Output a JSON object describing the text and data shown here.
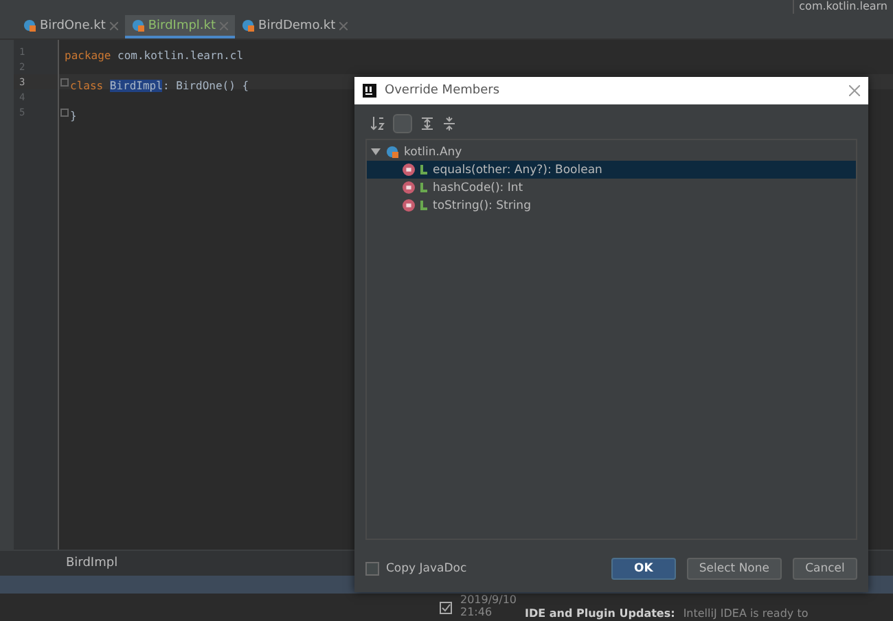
{
  "toolbar": {
    "project_field": "com.kotlin.learn"
  },
  "tabs": [
    {
      "label": "BirdOne.kt",
      "selected": false
    },
    {
      "label": "BirdImpl.kt",
      "selected": true
    },
    {
      "label": "BirdDemo.kt",
      "selected": false
    }
  ],
  "editor": {
    "lines": [
      {
        "number": "1",
        "current": false,
        "fold": false,
        "tokens": [
          {
            "kind": "keyword",
            "text": "package"
          },
          {
            "kind": "plain",
            "text": " com.kotlin.learn.cl"
          }
        ]
      },
      {
        "number": "2",
        "current": false,
        "fold": false
      },
      {
        "number": "3",
        "current": true,
        "fold": true,
        "tokens": [
          {
            "kind": "keyword",
            "text": "class "
          },
          {
            "kind": "highlight",
            "text": "BirdImpl"
          },
          {
            "kind": "plain",
            "text": ": BirdOne() {"
          }
        ]
      },
      {
        "number": "4",
        "current": false,
        "fold": false
      },
      {
        "number": "5",
        "current": false,
        "fold": true,
        "tokens": [
          {
            "kind": "plain",
            "text": "}"
          }
        ]
      }
    ],
    "breadcrumb": "BirdImpl"
  },
  "dialog": {
    "title": "Override Members",
    "tree": {
      "label": "kotlin.Any",
      "expanded": true,
      "children": [
        {
          "label": "equals(other: Any?): Boolean",
          "selected": true
        },
        {
          "label": "hashCode(): Int",
          "selected": false
        },
        {
          "label": "toString(): String",
          "selected": false
        }
      ]
    },
    "copy_javadoc": {
      "label": "Copy JavaDoc",
      "checked": false
    },
    "buttons": [
      {
        "label": "OK",
        "kind": "primary"
      },
      {
        "label": "Select None",
        "kind": "normal"
      },
      {
        "label": "Cancel",
        "kind": "normal"
      }
    ]
  },
  "notification": {
    "date": "2019/9/10",
    "time": "21:46",
    "title": "IDE and Plugin Updates:",
    "text": "IntelliJ IDEA is ready to"
  }
}
